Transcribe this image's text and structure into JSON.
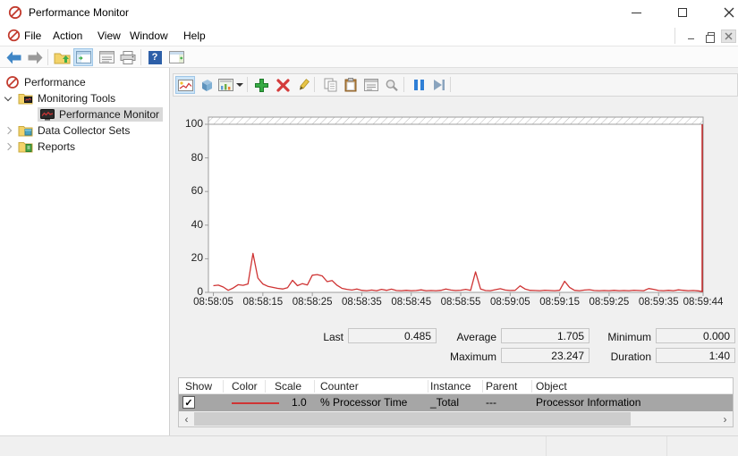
{
  "window": {
    "title": "Performance Monitor"
  },
  "icons": {
    "help_glyph": "?",
    "check": "✓",
    "scroll_left": "‹",
    "scroll_right": "›"
  },
  "colors": {
    "series_red": "#cf3434",
    "marker_red": "#c01818",
    "toolbar_highlight": "#cce4f7",
    "row_selection": "#a6a6a6",
    "tree_selection": "#d9d9d9"
  },
  "menu_bar": {
    "items": [
      "File",
      "Action",
      "View",
      "Window",
      "Help"
    ]
  },
  "main_toolbar": {
    "buttons": [
      "back",
      "forward",
      "up-one-level",
      "show-hide-console-tree",
      "export-list",
      "print",
      "help",
      "show-hide-action-pane"
    ]
  },
  "tree": {
    "root": {
      "label": "Performance"
    },
    "items": [
      {
        "label": "Monitoring Tools",
        "state": "expanded"
      },
      {
        "label": "Performance Monitor",
        "selected": true
      },
      {
        "label": "Data Collector Sets",
        "state": "collapsed"
      },
      {
        "label": "Reports",
        "state": "collapsed"
      }
    ]
  },
  "chart_toolbar": {
    "buttons": [
      "view-current-activity",
      "view-log-data",
      "change-graph-type",
      "add-counter",
      "delete-counter",
      "highlight",
      "copy-properties",
      "paste-counter-list",
      "properties",
      "zoom",
      "freeze-display",
      "update-data"
    ],
    "active_button": "view-current-activity"
  },
  "chart_data": {
    "type": "line",
    "title": "",
    "xlabel": "",
    "ylabel": "",
    "ylim": [
      0,
      100
    ],
    "yticks": [
      0,
      20,
      40,
      60,
      80,
      100
    ],
    "x_labels": [
      "08:58:05",
      "08:58:15",
      "08:58:25",
      "08:58:35",
      "08:58:45",
      "08:58:55",
      "08:59:05",
      "08:59:15",
      "08:59:25",
      "08:59:35",
      "08:59:44"
    ],
    "x_label_offsets_seconds": [
      1,
      11,
      21,
      31,
      41,
      51,
      61,
      71,
      81,
      91,
      100
    ],
    "x_range_seconds": 100,
    "grid": "top hatch band only",
    "legend_position": "bottom-table",
    "current_position_marker": "right-edge",
    "series": [
      {
        "name": "% Processor Time",
        "color": "#cf3434",
        "values": [
          4.0,
          4.3,
          3.2,
          1.2,
          2.6,
          4.6,
          4.2,
          5.0,
          23.2,
          8.5,
          5.0,
          3.6,
          3.0,
          2.4,
          2.0,
          2.8,
          7.2,
          4.0,
          5.2,
          4.4,
          10.2,
          10.6,
          9.8,
          6.4,
          7.0,
          4.2,
          2.4,
          1.8,
          1.4,
          2.0,
          1.2,
          1.0,
          1.4,
          1.0,
          1.8,
          1.2,
          1.9,
          1.1,
          1.0,
          1.2,
          1.0,
          1.1,
          1.5,
          1.0,
          1.1,
          1.0,
          1.2,
          2.0,
          1.4,
          1.1,
          1.3,
          1.8,
          1.2,
          12.2,
          2.0,
          1.1,
          1.0,
          1.6,
          2.2,
          1.4,
          1.1,
          1.2,
          3.9,
          2.0,
          1.2,
          1.1,
          1.0,
          1.3,
          1.1,
          1.0,
          1.2,
          6.6,
          3.0,
          1.2,
          1.0,
          1.4,
          1.6,
          1.1,
          1.0,
          1.1,
          1.0,
          1.2,
          1.0,
          1.1,
          1.0,
          1.3,
          1.1,
          1.0,
          2.3,
          1.8,
          1.1,
          1.0,
          1.2,
          1.0,
          1.5,
          1.2,
          1.0,
          1.1,
          0.9,
          0.485
        ]
      }
    ]
  },
  "stats": {
    "last": {
      "label": "Last",
      "value": "0.485"
    },
    "average": {
      "label": "Average",
      "value": "1.705"
    },
    "minimum": {
      "label": "Minimum",
      "value": "0.000"
    },
    "maximum": {
      "label": "Maximum",
      "value": "23.247"
    },
    "duration": {
      "label": "Duration",
      "value": "1:40"
    }
  },
  "legend_table": {
    "columns": [
      "Show",
      "Color",
      "Scale",
      "Counter",
      "Instance",
      "Parent",
      "Object"
    ],
    "rows": [
      {
        "show": true,
        "color": "#cf3434",
        "scale": "1.0",
        "counter": "% Processor Time",
        "instance": "_Total",
        "parent": "---",
        "object": "Processor Information",
        "selected": true
      }
    ]
  }
}
